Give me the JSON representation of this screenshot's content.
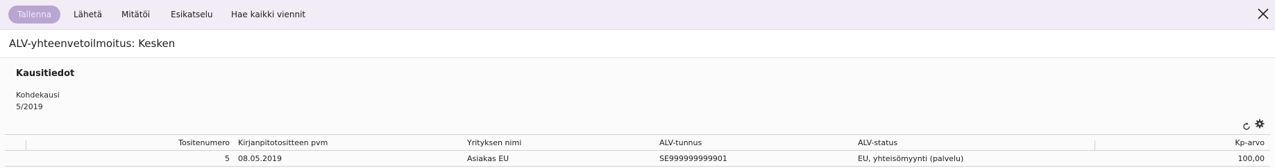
{
  "toolbar": {
    "save_label": "Tallenna",
    "send_label": "Lähetä",
    "void_label": "Mitätöi",
    "preview_label": "Esikatselu",
    "fetch_all_label": "Hae kaikki viennit",
    "close_icon": "close-icon"
  },
  "page": {
    "title": "ALV-yhteenvetoilmoitus: Kesken"
  },
  "period_info": {
    "title": "Kausitiedot",
    "target_period_label": "Kohdekausi",
    "target_period_value": "5/2019"
  },
  "table": {
    "tools": [
      "refresh-icon",
      "settings-icon"
    ],
    "columns": [
      "Tositenumero",
      "Kirjanpitotositteen pvm",
      "Yrityksen nimi",
      "ALV-tunnus",
      "ALV-status",
      "Kp-arvo"
    ],
    "rows": [
      {
        "voucher_number": "5",
        "date": "08.05.2019",
        "company_name": "Asiakas EU",
        "vat_id": "SE999999999901",
        "vat_status": "EU, yhteisömyynti (palvelu)",
        "value": "100,00"
      }
    ]
  },
  "colors": {
    "toolbar_bg": "#f1ecf5",
    "primary_button_bg": "#b6a6d1",
    "primary_button_text": "#efeaf6"
  }
}
